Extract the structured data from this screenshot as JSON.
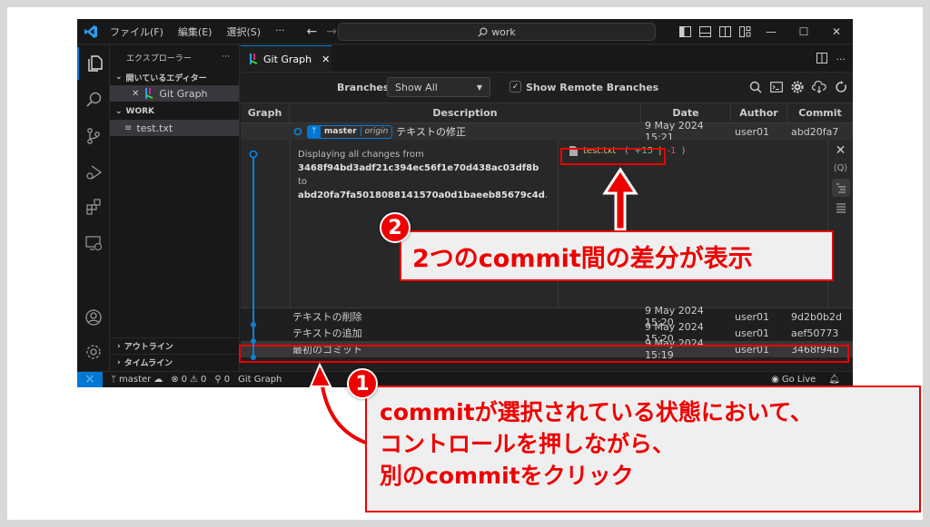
{
  "titlebar": {
    "menu": [
      "ファイル(F)",
      "編集(E)",
      "選択(S)",
      "···"
    ],
    "search": "work"
  },
  "sidebar": {
    "title": "エクスプローラー",
    "more": "···",
    "open_editors_label": "開いているエディター",
    "open_editor_item": "Git Graph",
    "workspace_label": "WORK",
    "files": [
      "test.txt"
    ],
    "outline_label": "アウトライン",
    "timeline_label": "タイムライン"
  },
  "tab": {
    "label": "Git Graph"
  },
  "controls": {
    "branches_label": "Branches:",
    "branches_value": "Show All",
    "show_remote_label": "Show Remote Branches",
    "show_remote_checked": true
  },
  "table": {
    "headers": [
      "Graph",
      "Description",
      "Date",
      "Author",
      "Commit"
    ],
    "rows": [
      {
        "description": "テキストの修正",
        "date": "9 May 2024 15:21",
        "author": "user01",
        "commit": "abd20fa7",
        "branch": "master",
        "remote": "origin"
      },
      {
        "description": "テキストの削除",
        "date": "9 May 2024 15:20",
        "author": "user01",
        "commit": "9d2b0b2d"
      },
      {
        "description": "テキストの追加",
        "date": "9 May 2024 15:20",
        "author": "user01",
        "commit": "aef50773"
      },
      {
        "description": "最初のコミット",
        "date": "9 May 2024 15:19",
        "author": "user01",
        "commit": "3468f94b"
      }
    ]
  },
  "details": {
    "line1": "Displaying all changes from",
    "from_hash": "3468f94bd3adf21c394ec56f1e70d438ac03df8b",
    "to_word": " to",
    "to_hash": "abd20fa7fa5018088141570a0d1baeeb85679c4d",
    "period": ".",
    "file_name": "test.txt",
    "additions": "+15",
    "deletions": "-1"
  },
  "statusbar": {
    "branch": "master",
    "errors": "0",
    "warnings": "0",
    "ports": "0",
    "git_graph": "Git Graph",
    "go_live": "Go Live"
  },
  "annotations": {
    "step2_number": "2",
    "step2_text": "2つのcommit間の差分が表示",
    "step1_number": "1",
    "step1_lines": [
      "commitが選択されている状態において、",
      "コントロールを押しながら、",
      "別のcommitをクリック"
    ]
  },
  "colors": {
    "accent": "#0078d4",
    "annotation_red": "#ee0000",
    "additions": "#73c991",
    "deletions": "#f14c4c"
  }
}
